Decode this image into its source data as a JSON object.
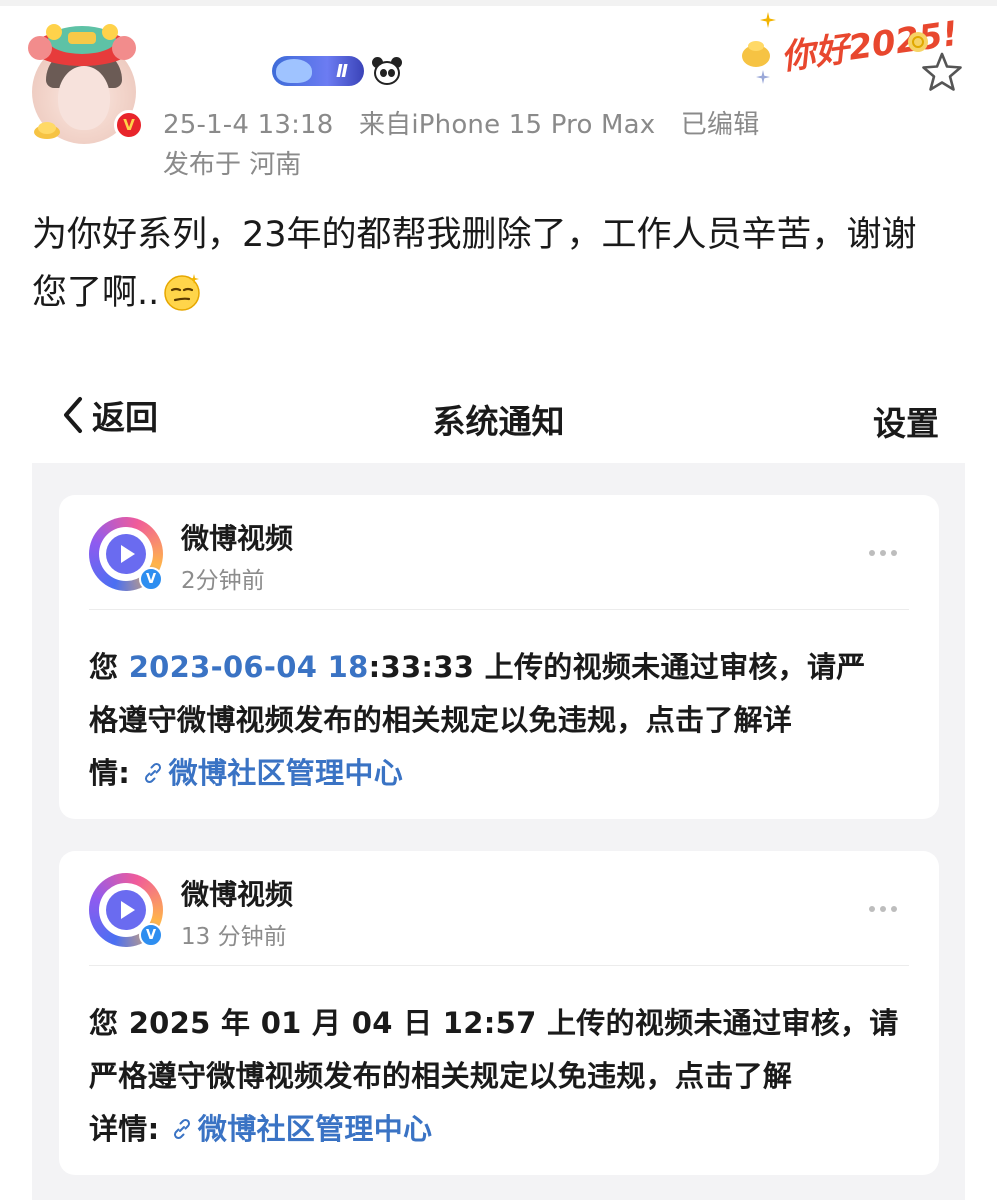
{
  "post": {
    "meta_time": "25-1-4 13:18",
    "meta_source": "来自iPhone 15 Pro Max",
    "meta_edited": "已编辑",
    "meta_location": "发布于 河南",
    "level_badge": "Ⅱ",
    "deco_text": "你好2025!",
    "text_line1": "为你好系列，23年的都帮我删除了，工作人员辛苦，谢谢",
    "text_line2": "您了啊..",
    "icons": [
      "avatar",
      "verified-badge",
      "level-badge",
      "panda-icon",
      "hello-2025-decoration",
      "star-icon",
      "smirk-emoji"
    ]
  },
  "screenshot": {
    "nav": {
      "back_label": "返回",
      "title": "系统通知",
      "settings_label": "设置"
    },
    "cards": [
      {
        "name": "微博视频",
        "avatar_label": "微博视",
        "time": "2分钟前",
        "body_prefix": "您 ",
        "body_highlight": "2023-06-04 18",
        "body_rest_line1": ":33:33 上传的视频未通过审核，请严",
        "body_line2": "格遵守微博视频发布的相关规定以免违规，点击了解详",
        "body_line3_prefix": "情: ",
        "link_label": "微博社区管理中心"
      },
      {
        "name": "微博视频",
        "avatar_label": "微博视",
        "time": "13 分钟前",
        "body_line1": "您 2025 年 01 月 04 日 12:57 上传的视频未通过审核，请",
        "body_line2": "严格遵守微博视频发布的相关规定以免违规，点击了解",
        "body_line3_prefix": "详情: ",
        "link_label": "微博社区管理中心"
      }
    ]
  },
  "colors": {
    "link_blue": "#3a73c4",
    "meta_gray": "#8a8a8a",
    "panel_bg": "#f3f3f5",
    "verified_red": "#e8252b",
    "deco_red": "#e8472e"
  }
}
